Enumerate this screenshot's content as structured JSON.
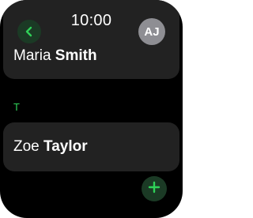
{
  "status": {
    "time": "10:00"
  },
  "header": {
    "back_icon": "chevron-left-icon",
    "avatar_initials": "AJ"
  },
  "contacts": [
    {
      "first": "Maria",
      "last": "Smith"
    }
  ],
  "sections": [
    {
      "letter": "T",
      "contacts": [
        {
          "first": "Zoe",
          "last": "Taylor"
        }
      ]
    }
  ],
  "actions": {
    "add_icon": "plus-icon"
  },
  "colors": {
    "accent": "#2fd158",
    "button_bg": "#1b3a25",
    "card_bg": "#222222",
    "avatar_bg": "#8e8e93"
  }
}
